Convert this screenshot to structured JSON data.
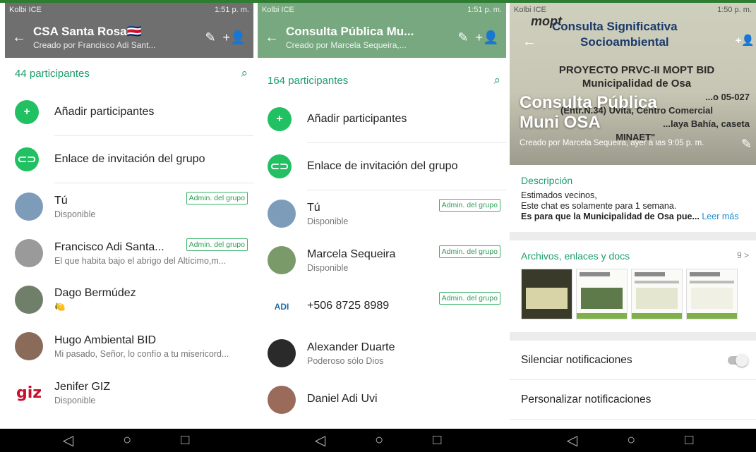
{
  "colors": {
    "accent": "#1c9e6b",
    "action_green": "#21c063",
    "header_gray": "#6f6f6f",
    "header_green": "#77a87f",
    "link": "#1a8bd0"
  },
  "panel1": {
    "status": {
      "carrier": "Kolbi ICE",
      "time": "1:51 p. m."
    },
    "header": {
      "title": "CSA Santa Rosa🇨🇷",
      "subtitle": "Creado por Francisco Adi Sant..."
    },
    "count": "44 participantes",
    "actions": [
      {
        "icon": "add-participant-icon",
        "label": "Añadir participantes"
      },
      {
        "icon": "link-icon",
        "label": "Enlace de invitación del grupo"
      }
    ],
    "members": [
      {
        "name": "Tú",
        "status": "Disponible",
        "badge": "Admin. del grupo",
        "avatar": "#7d9cba"
      },
      {
        "name": "Francisco Adi Santa...",
        "status": "El que habita bajo el abrigo del Altícimo,m...",
        "badge": "Admin. del grupo",
        "avatar": "#9a9a9a"
      },
      {
        "name": "Dago Bermúdez",
        "status": "🍋",
        "badge": "",
        "avatar": "#6f7f6a"
      },
      {
        "name": "Hugo Ambiental BID",
        "status": "Mi pasado, Señor, lo confío a tu misericord...",
        "badge": "",
        "avatar": "#8a6b5a"
      },
      {
        "name": "Jenifer GIZ",
        "status": "Disponible",
        "badge": "",
        "avatar": "#ffffff"
      }
    ]
  },
  "panel2": {
    "status": {
      "carrier": "Kolbi ICE",
      "time": "1:51 p. m."
    },
    "header": {
      "title": "Consulta Pública Mu...",
      "subtitle": "Creado por Marcela Sequeira,..."
    },
    "count": "164 participantes",
    "actions": [
      {
        "icon": "add-participant-icon",
        "label": "Añadir participantes"
      },
      {
        "icon": "link-icon",
        "label": "Enlace de invitación del grupo"
      }
    ],
    "members": [
      {
        "name": "Tú",
        "status": "Disponible",
        "badge": "Admin. del grupo",
        "avatar": "#7d9cba"
      },
      {
        "name": "Marcela Sequeira",
        "status": "Disponible",
        "badge": "Admin. del grupo",
        "avatar": "#7a9a6a"
      },
      {
        "name": "+506 8725 8989",
        "status": "",
        "badge": "Admin. del grupo",
        "avatar": "#ffffff"
      },
      {
        "name": "Alexander Duarte",
        "status": "Poderoso sólo Dios",
        "badge": "",
        "avatar": "#2a2a2a"
      },
      {
        "name": "Daniel Adi Uvi",
        "status": "",
        "badge": "",
        "avatar": "#9a6a5a"
      }
    ]
  },
  "panel3": {
    "status": {
      "carrier": "Kolbi ICE",
      "time": "1:50 p. m."
    },
    "cover": {
      "logo": "mopt",
      "line1": "Consulta Significativa",
      "line2": "Socioambiental",
      "body": [
        "PROYECTO PRVC-II MOPT BID",
        "Municipalidad de Osa",
        "...o 05-027",
        "(Entr.N.34) Uvita, Centro Comercial",
        "...laya Bahía, caseta",
        "MINAET\"."
      ],
      "title": "Consulta Pública Muni OSA",
      "subtitle": "Creado por Marcela Sequeira, ayer a las 9:05 p. m."
    },
    "description": {
      "heading": "Descripción",
      "line1": "Estimados vecinos,",
      "line2": "Este chat es solamente para 1 semana.",
      "line3": "Es para que la Municipalidad de Osa pue...",
      "more": "Leer más"
    },
    "docs": {
      "heading": "Archivos, enlaces y docs",
      "count": "9 >"
    },
    "settings": [
      {
        "label": "Silenciar notificaciones"
      },
      {
        "label": "Personalizar notificaciones"
      }
    ]
  },
  "nav": {
    "back": "◁",
    "home": "○",
    "recent": "□"
  },
  "avatar_texts": {
    "giz": "giz",
    "adi": "ADI"
  }
}
